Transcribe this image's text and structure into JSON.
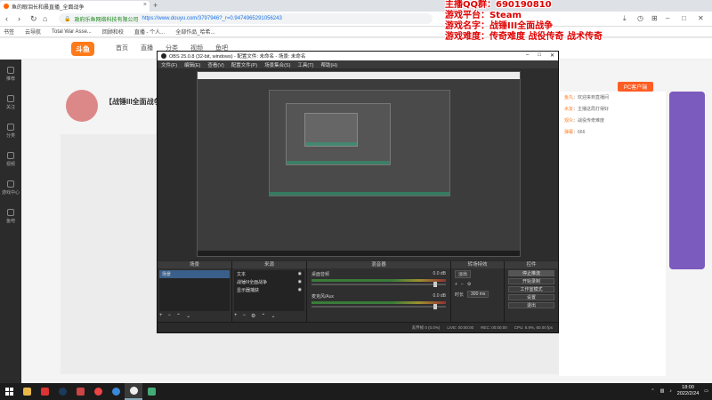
{
  "browser": {
    "tab_title": "鱼的眼泪长和晨直播_全面战争",
    "new_tab": "+",
    "secure_label": "政府乐鱼网络科技有限公司",
    "url": "https://www.douyu.com/3797946?_r=0.9474965291056243",
    "bookmarks": [
      "书签",
      "云导航",
      "Total War Asse...",
      "回顾和校",
      "直播 - 个人...",
      "全部作品_哈希..."
    ]
  },
  "overlay": {
    "line1": "主播QQ群：",
    "line1_value": "690190810",
    "line2": "游戏平台：Steam",
    "line3": "游戏名字：战锤III全面战争",
    "line4": "游戏难度：传奇难度 战役传奇 战术传奇"
  },
  "douyu": {
    "logo": "斗鱼",
    "nav": [
      "首页",
      "直播",
      "分类",
      "视频",
      "鱼吧"
    ],
    "room_title": "【战锤III全面战争",
    "follow_label": "PC客户端",
    "rail": [
      "推荐",
      "关注",
      "分类",
      "视频",
      "游戏中心",
      "鱼吧"
    ],
    "chat": [
      {
        "nick": "鱼丸",
        "text": "：欢迎来到直播间"
      },
      {
        "nick": "水友",
        "text": "：主播这局打得好"
      },
      {
        "nick": "观众",
        "text": "：战役传奇难度"
      },
      {
        "nick": "弹幕",
        "text": "：666"
      }
    ]
  },
  "obs": {
    "title": "OBS 25.0.8 (32-bit, windows) - 配置文件: 未命名 - 场景: 未命名",
    "menu": [
      "文件(F)",
      "编辑(E)",
      "查看(V)",
      "配置文件(P)",
      "场景集合(S)",
      "工具(T)",
      "帮助(H)"
    ],
    "docks": {
      "scenes": "场景",
      "sources": "来源",
      "mixer": "混音器",
      "transitions": "转场特效",
      "controls": "控件"
    },
    "scene_items": [
      "场景"
    ],
    "source_items": [
      "文本",
      "战锤III全面战争",
      "显示器捕获"
    ],
    "mixer_items": [
      {
        "name": "桌面音频",
        "db": "0.0 dB"
      },
      {
        "name": "麦克风/Aux",
        "db": "0.0 dB"
      }
    ],
    "transition": {
      "name": "淡出",
      "duration_label": "时长",
      "duration": "300 ms"
    },
    "controls": [
      "停止推流",
      "开始录制",
      "工作室模式",
      "设置",
      "退出"
    ],
    "status": {
      "dropped": "丢弃帧 0 (0.0%)",
      "live": "LIVE: 00:00:00",
      "rec": "REC: 00:00:00",
      "cpu": "CPU: 6.9%, 60.00 fps"
    }
  },
  "taskbar": {
    "time": "18:00",
    "date": "2022/2/24"
  }
}
